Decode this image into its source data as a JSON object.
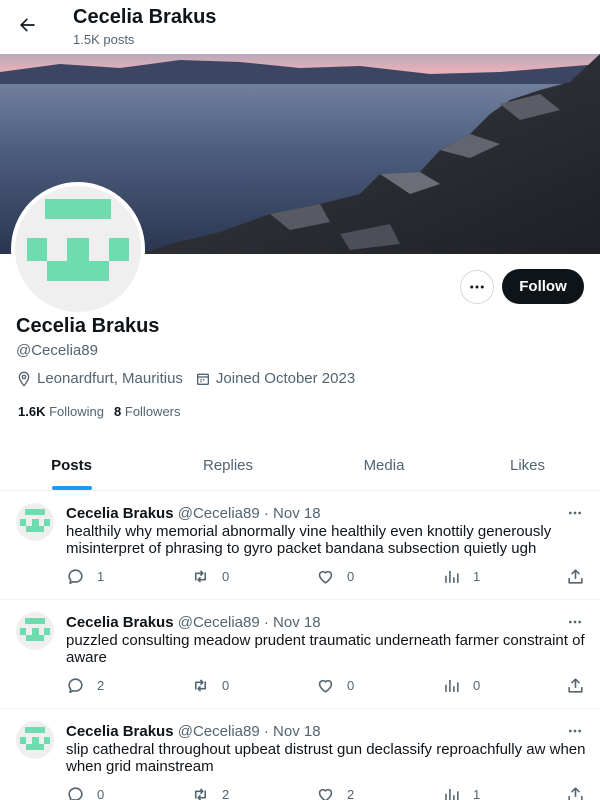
{
  "header": {
    "back_icon": "arrow-left-icon",
    "title": "Cecelia Brakus",
    "post_count": "1.5K posts"
  },
  "profile": {
    "display_name": "Cecelia Brakus",
    "handle": "@Cecelia89",
    "location": "Leonardfurt, Mauritius",
    "joined": "Joined October 2023",
    "following_count": "1.6K",
    "following_label": "Following",
    "followers_count": "8",
    "followers_label": "Followers",
    "follow_button": "Follow",
    "avatar_color": "#6fdcb0"
  },
  "tabs": [
    {
      "label": "Posts",
      "active": true
    },
    {
      "label": "Replies",
      "active": false
    },
    {
      "label": "Media",
      "active": false
    },
    {
      "label": "Likes",
      "active": false
    }
  ],
  "posts": [
    {
      "name": "Cecelia Brakus",
      "handle": "@Cecelia89",
      "separator": "·",
      "date": "Nov 18",
      "text": "healthily why memorial abnormally vine healthily even knottily generously misinterpret of phrasing to gyro packet bandana subsection quietly ugh",
      "replies": "1",
      "reposts": "0",
      "likes": "0",
      "views": "1"
    },
    {
      "name": "Cecelia Brakus",
      "handle": "@Cecelia89",
      "separator": "·",
      "date": "Nov 18",
      "text": "puzzled consulting meadow prudent traumatic underneath farmer constraint of aware",
      "replies": "2",
      "reposts": "0",
      "likes": "0",
      "views": "0"
    },
    {
      "name": "Cecelia Brakus",
      "handle": "@Cecelia89",
      "separator": "·",
      "date": "Nov 18",
      "text": "slip cathedral throughout upbeat distrust gun declassify reproachfully aw when when grid mainstream",
      "replies": "0",
      "reposts": "2",
      "likes": "2",
      "views": "1"
    }
  ]
}
